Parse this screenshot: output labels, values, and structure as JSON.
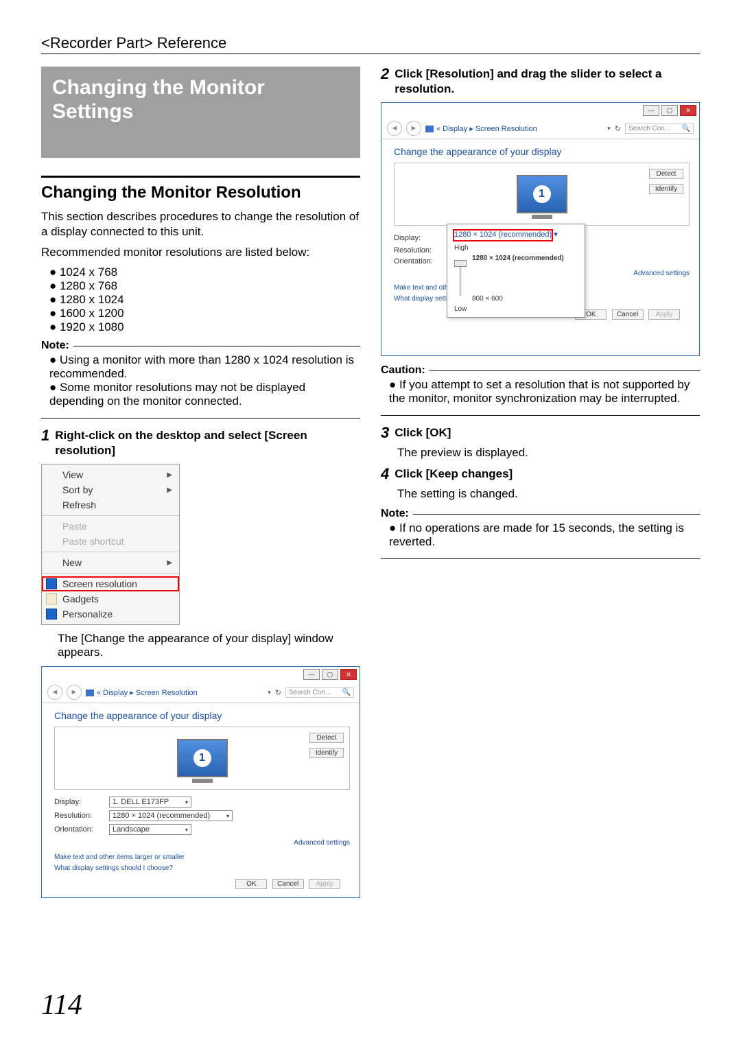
{
  "breadcrumb": "<Recorder Part> Reference",
  "title": "Changing the Monitor Settings",
  "section_title": "Changing the Monitor Resolution",
  "intro_p1": "This section describes procedures to change the resolution of a display connected to this unit.",
  "intro_p2": "Recommended monitor resolutions are listed below:",
  "resolutions": [
    "1024 x 768",
    "1280 x 768",
    "1280 x 1024",
    "1600 x 1200",
    "1920 x 1080"
  ],
  "note1_label": "Note:",
  "note1_items": [
    "Using a monitor with more than 1280 x 1024 resolution is recommended.",
    "Some monitor resolutions may not be displayed depending on the monitor connected."
  ],
  "step1_num": "1",
  "step1_text": "Right-click on the desktop and select [Screen resolution]",
  "context_menu": {
    "view": "View",
    "sortby": "Sort by",
    "refresh": "Refresh",
    "paste": "Paste",
    "paste_shortcut": "Paste shortcut",
    "new": "New",
    "screen_res": "Screen resolution",
    "gadgets": "Gadgets",
    "personalize": "Personalize"
  },
  "step1_after": "The [Change the appearance of your display] window appears.",
  "dialog": {
    "path": "« Display ▸ Screen Resolution",
    "search_placeholder": "Search Con...",
    "heading": "Change the appearance of your display",
    "detect": "Detect",
    "identify": "Identify",
    "monitor_num": "1",
    "display_label": "Display:",
    "display_value": "1. DELL E173FP",
    "resolution_label": "Resolution:",
    "resolution_value": "1280 × 1024 (recommended)",
    "orientation_label": "Orientation:",
    "orientation_value": "Landscape",
    "advanced": "Advanced settings",
    "help1": "Make text and other items larger or smaller",
    "help2": "What display settings should I choose?",
    "ok": "OK",
    "cancel": "Cancel",
    "apply": "Apply"
  },
  "step2_num": "2",
  "step2_text": "Click [Resolution] and drag the slider to select a resolution.",
  "slider": {
    "high": "High",
    "recommended_res": "1280 × 1024 (recommended)",
    "low_res": "800 × 600",
    "low": "Low"
  },
  "caution_label": "Caution:",
  "caution_items": [
    "If you attempt to set a resolution that is not supported by the monitor, monitor synchronization may be interrupted."
  ],
  "step3_num": "3",
  "step3_text": "Click [OK]",
  "step3_desc": "The preview is displayed.",
  "step4_num": "4",
  "step4_text": "Click [Keep changes]",
  "step4_desc": "The setting is changed.",
  "note2_label": "Note:",
  "note2_items": [
    "If no operations are made for 15 seconds, the setting is reverted."
  ],
  "page_number": "114"
}
